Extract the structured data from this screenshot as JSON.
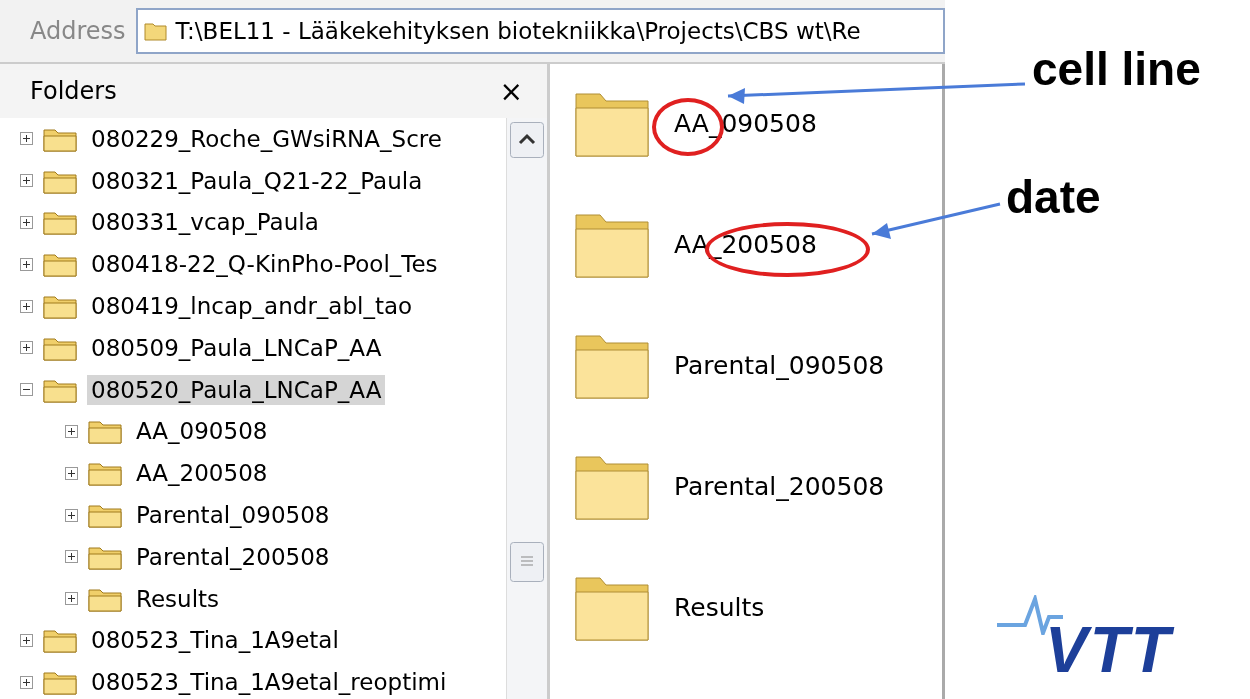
{
  "address": {
    "label": "Address",
    "value": "T:\\BEL11 - Lääkekehityksen biotekniikka\\Projects\\CBS wt\\Re"
  },
  "folders_pane": {
    "title": "Folders",
    "close": "×"
  },
  "tree": [
    {
      "label": "080229_Roche_GWsiRNA_Scre",
      "expanded": false,
      "selected": false
    },
    {
      "label": "080321_Paula_Q21-22_Paula",
      "expanded": false,
      "selected": false
    },
    {
      "label": "080331_vcap_Paula",
      "expanded": false,
      "selected": false
    },
    {
      "label": "080418-22_Q-KinPho-Pool_Tes",
      "expanded": false,
      "selected": false
    },
    {
      "label": "080419_lncap_andr_abl_tao",
      "expanded": false,
      "selected": false
    },
    {
      "label": "080509_Paula_LNCaP_AA",
      "expanded": false,
      "selected": false
    },
    {
      "label": "080520_Paula_LNCaP_AA",
      "expanded": true,
      "selected": true,
      "children": [
        {
          "label": "AA_090508",
          "expanded": false,
          "selected": false
        },
        {
          "label": "AA_200508",
          "expanded": false,
          "selected": false
        },
        {
          "label": "Parental_090508",
          "expanded": false,
          "selected": false
        },
        {
          "label": "Parental_200508",
          "expanded": false,
          "selected": false
        },
        {
          "label": "Results",
          "expanded": false,
          "selected": false
        }
      ]
    },
    {
      "label": "080523_Tina_1A9etal",
      "expanded": false,
      "selected": false
    },
    {
      "label": "080523_Tina_1A9etal_reoptimi",
      "expanded": false,
      "selected": false
    }
  ],
  "files": [
    {
      "name": "AA_090508"
    },
    {
      "name": "AA_200508"
    },
    {
      "name": "Parental_090508"
    },
    {
      "name": "Parental_200508"
    },
    {
      "name": "Results"
    }
  ],
  "annotations": [
    {
      "label": "cell line"
    },
    {
      "label": "date"
    }
  ],
  "logo": {
    "text": "VTT"
  }
}
